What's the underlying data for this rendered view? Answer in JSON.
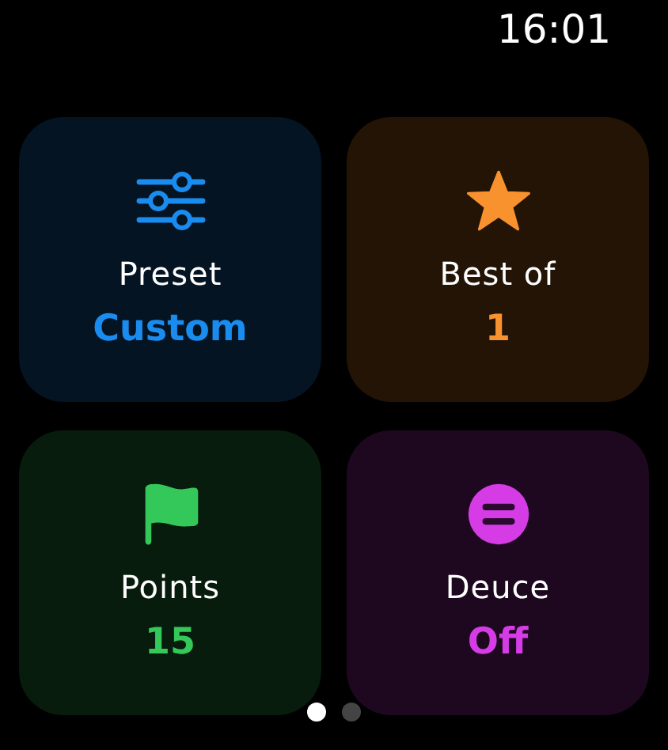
{
  "status_bar": {
    "time": "16:01"
  },
  "tiles": [
    {
      "kind": "sliders",
      "label": "Preset",
      "value": "Custom",
      "color": "#1a8cf0"
    },
    {
      "kind": "star",
      "label": "Best of",
      "value": "1",
      "color": "#f7922e"
    },
    {
      "kind": "flag",
      "label": "Points",
      "value": "15",
      "color": "#34c759"
    },
    {
      "kind": "equal",
      "label": "Deuce",
      "value": "Off",
      "color": "#d63ce6"
    }
  ],
  "page_dots": [
    {
      "selected": true
    },
    {
      "selected": false
    }
  ]
}
